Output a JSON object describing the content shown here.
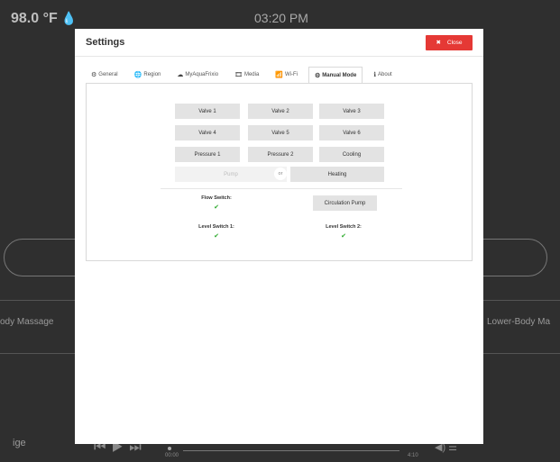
{
  "background": {
    "temperature": "98.0 °F",
    "clock": "03:20 PM",
    "left_label": "ody Massage",
    "right_label": "Lower-Body Ma",
    "bottom_left_label": "ige",
    "player_controls": "⏮ ▶ ⏭",
    "time_start": "00:00",
    "time_end": "4:10",
    "volume": "◀) ☰"
  },
  "modal": {
    "title": "Settings",
    "close_label": "Close",
    "tabs": [
      {
        "label": "General",
        "icon": "gear-icon"
      },
      {
        "label": "Region",
        "icon": "globe-icon"
      },
      {
        "label": "MyAquaFrixio",
        "icon": "cloud-icon"
      },
      {
        "label": "Media",
        "icon": "film-icon"
      },
      {
        "label": "Wi-Fi",
        "icon": "wifi-icon"
      },
      {
        "label": "Manual Mode",
        "icon": "manual-icon"
      },
      {
        "label": "About",
        "icon": "info-icon"
      }
    ],
    "active_tab": "Manual Mode",
    "manual": {
      "valves": [
        "Valve 1",
        "Valve 2",
        "Valve 3",
        "Valve 4",
        "Valve 5",
        "Valve 6"
      ],
      "pressure1": "Pressure 1",
      "pressure2": "Pressure 2",
      "cooling": "Cooling",
      "pump": "Pump",
      "or": "or",
      "heating": "Heating",
      "flow_switch": "Flow Switch:",
      "circulation_pump": "Circulation Pump",
      "level_switch_1": "Level Switch 1:",
      "level_switch_2": "Level Switch 2:",
      "check": "✔"
    }
  }
}
